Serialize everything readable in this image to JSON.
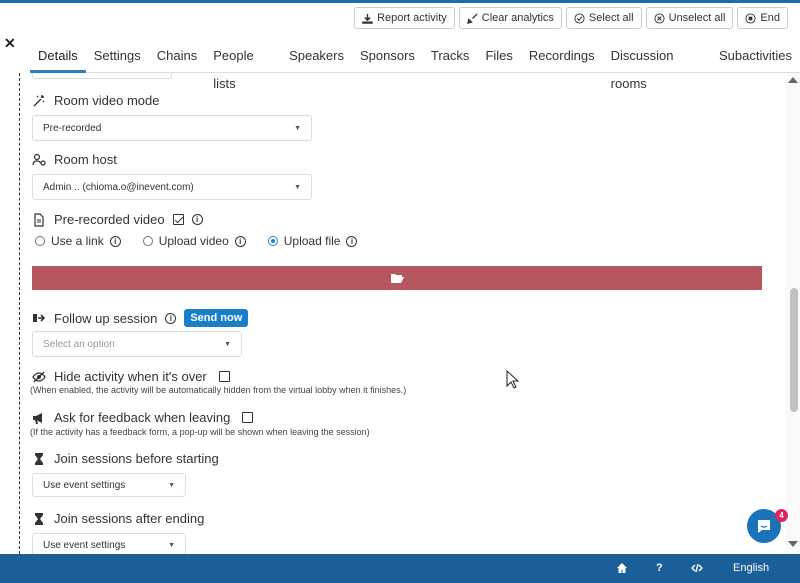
{
  "toolbar": {
    "report_label": "Report activity",
    "clear_label": "Clear analytics",
    "select_all_label": "Select all",
    "unselect_all_label": "Unselect all",
    "end_label": "End"
  },
  "close_label": "✕",
  "tabs": [
    {
      "label": "Details",
      "active": true
    },
    {
      "label": "Settings"
    },
    {
      "label": "Chains"
    },
    {
      "label": "People lists"
    },
    {
      "label": "Speakers"
    },
    {
      "label": "Sponsors"
    },
    {
      "label": "Tracks"
    },
    {
      "label": "Files"
    },
    {
      "label": "Recordings"
    },
    {
      "label": "Discussion rooms"
    },
    {
      "label": "Subactivities"
    }
  ],
  "form": {
    "video_mode": {
      "label": "Room video mode",
      "value": "Pre-recorded"
    },
    "room_host": {
      "label": "Room host",
      "value": "Admin .. (chioma.o@inevent.com)"
    },
    "prerecorded": {
      "label": "Pre-recorded video",
      "checked": true
    },
    "source_options": [
      {
        "label": "Use a link",
        "selected": false
      },
      {
        "label": "Upload video",
        "selected": false
      },
      {
        "label": "Upload file",
        "selected": true
      }
    ],
    "follow_up": {
      "label": "Follow up session",
      "button": "Send now",
      "placeholder": "Select an option"
    },
    "hide_activity": {
      "label": "Hide activity when it's over",
      "help": "(When enabled, the activity will be automatically hidden from the virtual lobby when it finishes.)"
    },
    "feedback": {
      "label": "Ask for feedback when leaving",
      "help": "(If the activity has a feedback form, a pop-up will be shown when leaving the session)"
    },
    "join_before": {
      "label": "Join sessions before starting",
      "value": "Use event settings"
    },
    "join_after": {
      "label": "Join sessions after ending",
      "value": "Use event settings"
    }
  },
  "footer": {
    "language": "English",
    "help": "?"
  },
  "chat_badge": "4",
  "colors": {
    "accent": "#1b5f99",
    "upload_bar": "#b5575e",
    "send_button": "#1a7fc9",
    "badge": "#e0245e"
  }
}
